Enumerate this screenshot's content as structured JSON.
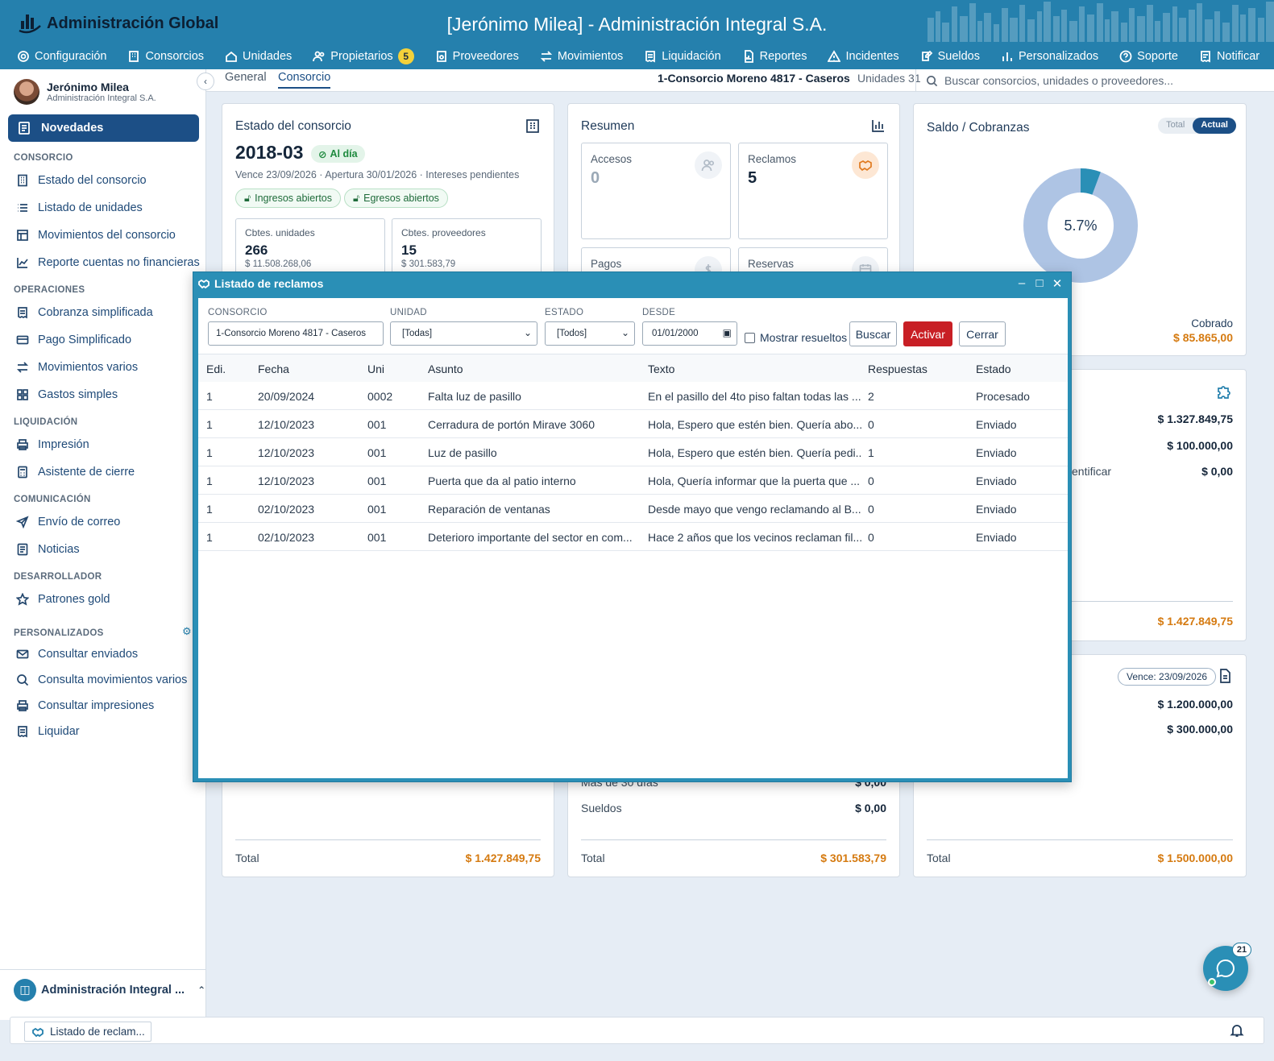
{
  "header": {
    "brand": "Administración Global",
    "title": "[Jerónimo Milea] - Administración Integral S.A.",
    "nav": [
      {
        "label": "Configuración",
        "icon": "gear-icon"
      },
      {
        "label": "Consorcios",
        "icon": "building-icon"
      },
      {
        "label": "Unidades",
        "icon": "home-icon"
      },
      {
        "label": "Propietarios",
        "icon": "users-icon",
        "badge": "5"
      },
      {
        "label": "Proveedores",
        "icon": "store-icon"
      },
      {
        "label": "Movimientos",
        "icon": "arrows-icon"
      },
      {
        "label": "Liquidación",
        "icon": "receipt-icon"
      },
      {
        "label": "Reportes",
        "icon": "report-icon"
      },
      {
        "label": "Incidentes",
        "icon": "warning-icon"
      },
      {
        "label": "Sueldos",
        "icon": "edit-icon"
      },
      {
        "label": "Personalizados",
        "icon": "bars-icon"
      },
      {
        "label": "Soporte",
        "icon": "help-icon"
      },
      {
        "label": "Notificar",
        "icon": "notify-icon"
      }
    ]
  },
  "sidebar": {
    "user_name": "Jerónimo Milea",
    "user_company": "Administración Integral S.A.",
    "active_item": "Novedades",
    "sections": {
      "consorcio": "CONSORCIO",
      "operaciones": "OPERACIONES",
      "liquidacion": "LIQUIDACIÓN",
      "comunicacion": "COMUNICACIÓN",
      "desarrollador": "DESARROLLADOR",
      "personalizados": "PERSONALIZADOS"
    },
    "items": {
      "estado": "Estado del consorcio",
      "listado": "Listado de unidades",
      "movimientos": "Movimientos del consorcio",
      "reporte": "Reporte cuentas no financieras",
      "cobranza": "Cobranza simplificada",
      "pago": "Pago Simplificado",
      "movvarios": "Movimientos varios",
      "gastos": "Gastos simples",
      "impresion": "Impresión",
      "asistente": "Asistente de cierre",
      "envio": "Envío de correo",
      "noticias": "Noticias",
      "patrones": "Patrones gold",
      "consultar_enviados": "Consultar enviados",
      "consulta_mov": "Consulta movimientos varios",
      "consultar_imp": "Consultar impresiones",
      "liquidar": "Liquidar"
    },
    "footer": "Administración Integral ..."
  },
  "subheader": {
    "tabs": [
      "General",
      "Consorcio"
    ],
    "consorcio": "1-Consorcio Moreno 4817 - Caseros",
    "unidades": "Unidades 31",
    "search_placeholder": "Buscar consorcios, unidades o proveedores..."
  },
  "estado": {
    "title": "Estado del consorcio",
    "period": "2018-03",
    "status": "Al día",
    "meta": "Vence 23/09/2026 · Apertura 30/01/2026 · Intereses pendientes",
    "pill_ingresos": "Ingresos abiertos",
    "pill_egresos": "Egresos abiertos",
    "cbtes_unidades_label": "Cbtes. unidades",
    "cbtes_unidades_count": "266",
    "cbtes_unidades_amount": "$ 11.508.268,06",
    "cbtes_prov_label": "Cbtes. proveedores",
    "cbtes_prov_count": "15",
    "cbtes_prov_amount": "$ 301.583,79",
    "total_label": "Total",
    "total_amount": "$ 1.427.849,75"
  },
  "resumen": {
    "title": "Resumen",
    "accesos_label": "Accesos",
    "accesos_value": "0",
    "reclamos_label": "Reclamos",
    "reclamos_value": "5",
    "pagos_label": "Pagos",
    "reservas_label": "Reservas",
    "mas30_label": "Más de 30 días",
    "mas30_amount": "$ 0,00",
    "sueldos_label": "Sueldos",
    "sueldos_amount": "$ 0,00",
    "total_label": "Total",
    "total_amount": "$ 301.583,79"
  },
  "saldo": {
    "title": "Saldo / Cobranzas",
    "seg_total": "Total",
    "seg_actual": "Actual",
    "percent_label": "5.7%",
    "percent_value": 5.7,
    "cobrado_label": "Cobrado",
    "cobrado_amount": "$ 85.865,00",
    "colors": {
      "ring": "#aec4e4",
      "slice": "#2a8fb6"
    }
  },
  "card2": {
    "amount1": "$ 1.327.849,75",
    "amount2": "$ 100.000,00",
    "row3_label": "entificar",
    "amount3": "$ 0,00",
    "total_amount": "$ 1.427.849,75"
  },
  "card3": {
    "vence": "Vence: 23/09/2026",
    "amount1": "$ 1.200.000,00",
    "amount2": "$ 300.000,00",
    "total_label": "Total",
    "total_amount": "$ 1.500.000,00"
  },
  "modal": {
    "title": "Listado de reclamos",
    "filters": {
      "consorcio_label": "CONSORCIO",
      "consorcio_value": "1-Consorcio Moreno 4817 - Caseros",
      "unidad_label": "UNIDAD",
      "unidad_value": "[Todas]",
      "estado_label": "ESTADO",
      "estado_value": "[Todos]",
      "desde_label": "DESDE",
      "desde_value": "01/01/2000",
      "mostrar_resueltos": "Mostrar resueltos"
    },
    "buttons": {
      "buscar": "Buscar",
      "activar": "Activar",
      "cerrar": "Cerrar"
    },
    "columns": [
      "Edi.",
      "Fecha",
      "Uni",
      "Asunto",
      "Texto",
      "Respuestas",
      "Estado"
    ],
    "rows": [
      [
        "1",
        "20/09/2024",
        "0002",
        "Falta luz de pasillo",
        "En el pasillo del 4to piso faltan todas las ...",
        "2",
        "Procesado"
      ],
      [
        "1",
        "12/10/2023",
        "001",
        "Cerradura de portón Mirave 3060",
        "Hola, Espero que estén bien. Quería abo...",
        "0",
        "Enviado"
      ],
      [
        "1",
        "12/10/2023",
        "001",
        "Luz de pasillo",
        "Hola, Espero que estén bien. Quería pedi...",
        "1",
        "Enviado"
      ],
      [
        "1",
        "12/10/2023",
        "001",
        "Puerta que da al patio interno",
        "Hola, Quería informar que la puerta que ...",
        "0",
        "Enviado"
      ],
      [
        "1",
        "02/10/2023",
        "001",
        "Reparación de ventanas",
        "Desde mayo que vengo reclamando al B...",
        "0",
        "Enviado"
      ],
      [
        "1",
        "02/10/2023",
        "001",
        "Deterioro importante del sector en com...",
        "Hace 2 años que los vecinos reclaman fil...",
        "0",
        "Enviado"
      ]
    ]
  },
  "taskbar": {
    "item": "Listado de reclam..."
  },
  "chat": {
    "count": "21"
  }
}
